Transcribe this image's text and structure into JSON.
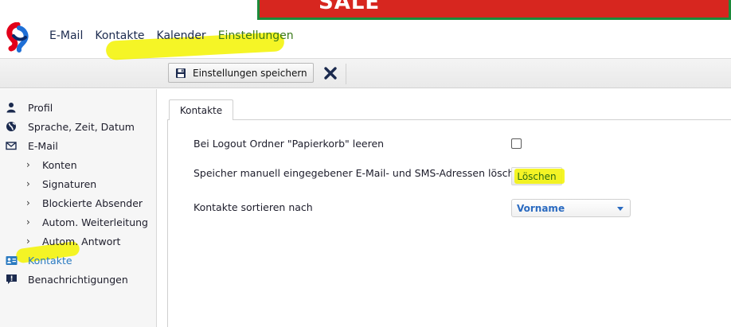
{
  "ad": {
    "text": "SALE"
  },
  "topnav": {
    "items": [
      {
        "label": "E-Mail"
      },
      {
        "label": "Kontakte"
      },
      {
        "label": "Kalender"
      },
      {
        "label": "Einstellungen"
      }
    ]
  },
  "toolbar": {
    "save_label": "Einstellungen speichern"
  },
  "sidebar": {
    "items": [
      {
        "label": "Profil",
        "icon": "user-icon"
      },
      {
        "label": "Sprache, Zeit, Datum",
        "icon": "globe-icon"
      },
      {
        "label": "E-Mail",
        "icon": "envelope-icon"
      },
      {
        "label": "Konten"
      },
      {
        "label": "Signaturen"
      },
      {
        "label": "Blockierte Absender"
      },
      {
        "label": "Autom. Weiterleitung"
      },
      {
        "label": "Autom. Antwort"
      },
      {
        "label": "Kontakte",
        "icon": "contact-card-icon"
      },
      {
        "label": "Benachrichtigungen",
        "icon": "notification-icon"
      }
    ]
  },
  "content": {
    "tab_label": "Kontakte",
    "settings": [
      {
        "label": "Bei Logout Ordner \"Papierkorb\" leeren"
      },
      {
        "label": "Speicher manuell eingegebener E-Mail- und SMS-Adressen löschen",
        "button": "Löschen"
      },
      {
        "label": "Kontakte sortieren nach",
        "value": "Vorname"
      }
    ]
  },
  "colors": {
    "highlight": "#f3f300",
    "accent": "#2a6ac0",
    "ad_red": "#d7261f",
    "nav_text": "#1b2a4e"
  }
}
